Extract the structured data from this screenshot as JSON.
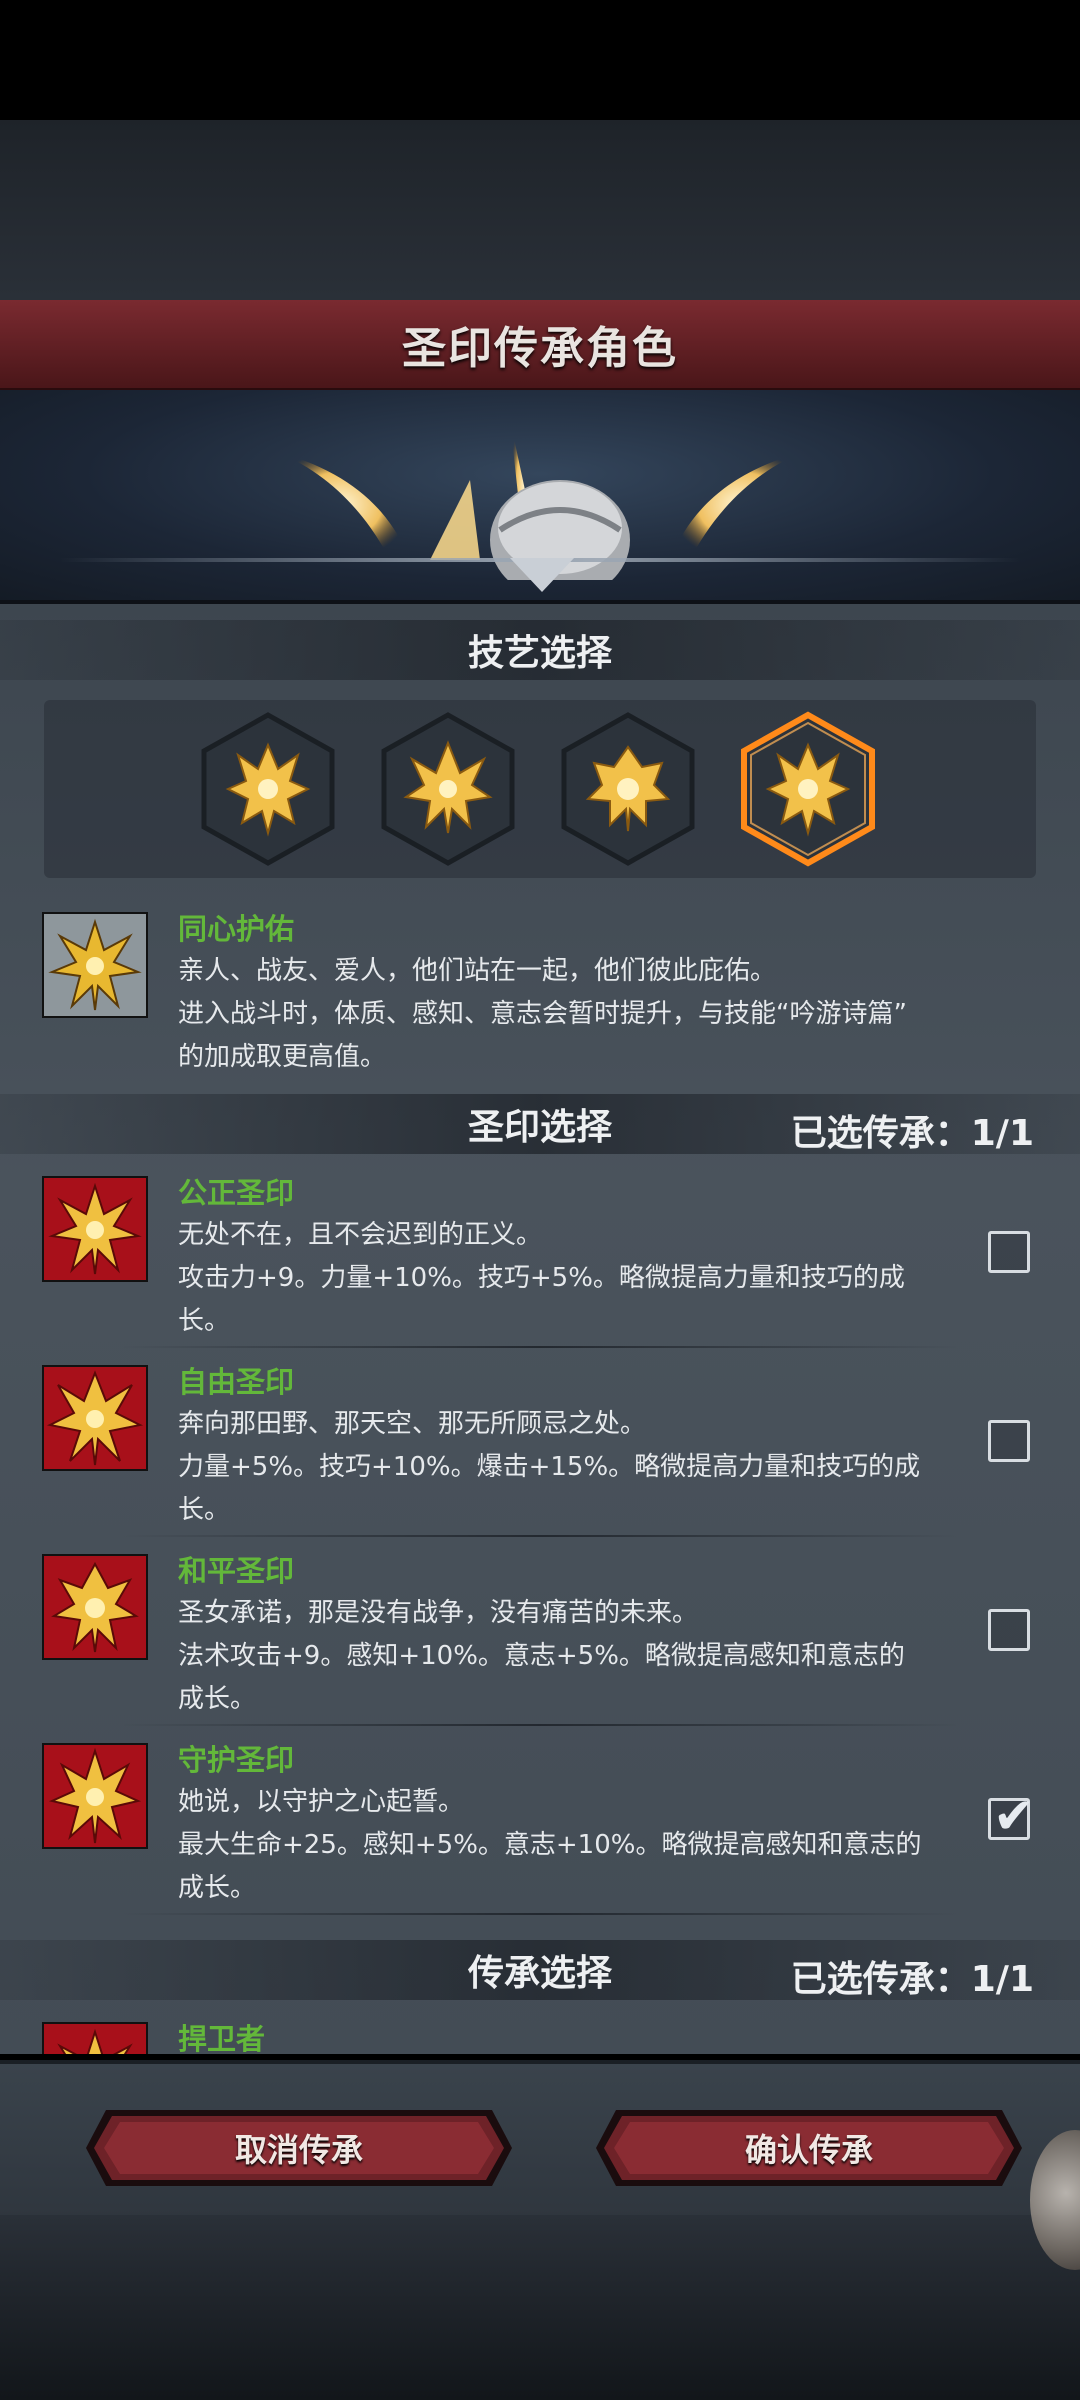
{
  "window": {
    "title": "圣印传承角色"
  },
  "skills": {
    "header": "技艺选择",
    "icons": [
      "crest-icon-1",
      "crest-icon-2",
      "crest-icon-3",
      "crest-icon-4"
    ],
    "selected_index": 3,
    "selected": {
      "name": "同心护佑",
      "lines": [
        "亲人、战友、爱人，他们站在一起，他们彼此庇佑。",
        "进入战斗时，体质、感知、意志会暂时提升，与技能“吟游诗篇”",
        "的加成取更高值。"
      ]
    }
  },
  "seals": {
    "header": "圣印选择",
    "selected_label": "已选传承：1/1",
    "items": [
      {
        "name": "公正圣印",
        "lines": [
          "无处不在，且不会迟到的正义。",
          "攻击力+9。力量+10%。技巧+5%。略微提高力量和技巧的成",
          "长。"
        ],
        "checked": false
      },
      {
        "name": "自由圣印",
        "lines": [
          "奔向那田野、那天空、那无所顾忌之处。",
          "力量+5%。技巧+10%。爆击+15%。略微提高力量和技巧的成",
          "长。"
        ],
        "checked": false
      },
      {
        "name": "和平圣印",
        "lines": [
          "圣女承诺，那是没有战争，没有痛苦的未来。",
          "法术攻击+9。感知+10%。意志+5%。略微提高感知和意志的",
          "成长。"
        ],
        "checked": false
      },
      {
        "name": "守护圣印",
        "lines": [
          "她说，以守护之心起誓。",
          "最大生命+25。感知+5%。意志+10%。略微提高感知和意志的",
          "成长。"
        ],
        "checked": true
      }
    ]
  },
  "inheritance": {
    "header": "传承选择",
    "selected_label": "已选传承：1/1",
    "items": [
      {
        "name": "捍卫者"
      }
    ]
  },
  "buttons": {
    "cancel": "取消传承",
    "confirm": "确认传承"
  },
  "colors": {
    "title_bar": "#7a2a30",
    "name_green": "#63b83a",
    "selected_glow": "#ff8a1a",
    "gold": "#f2c14a",
    "seal_red": "#b3121a"
  }
}
